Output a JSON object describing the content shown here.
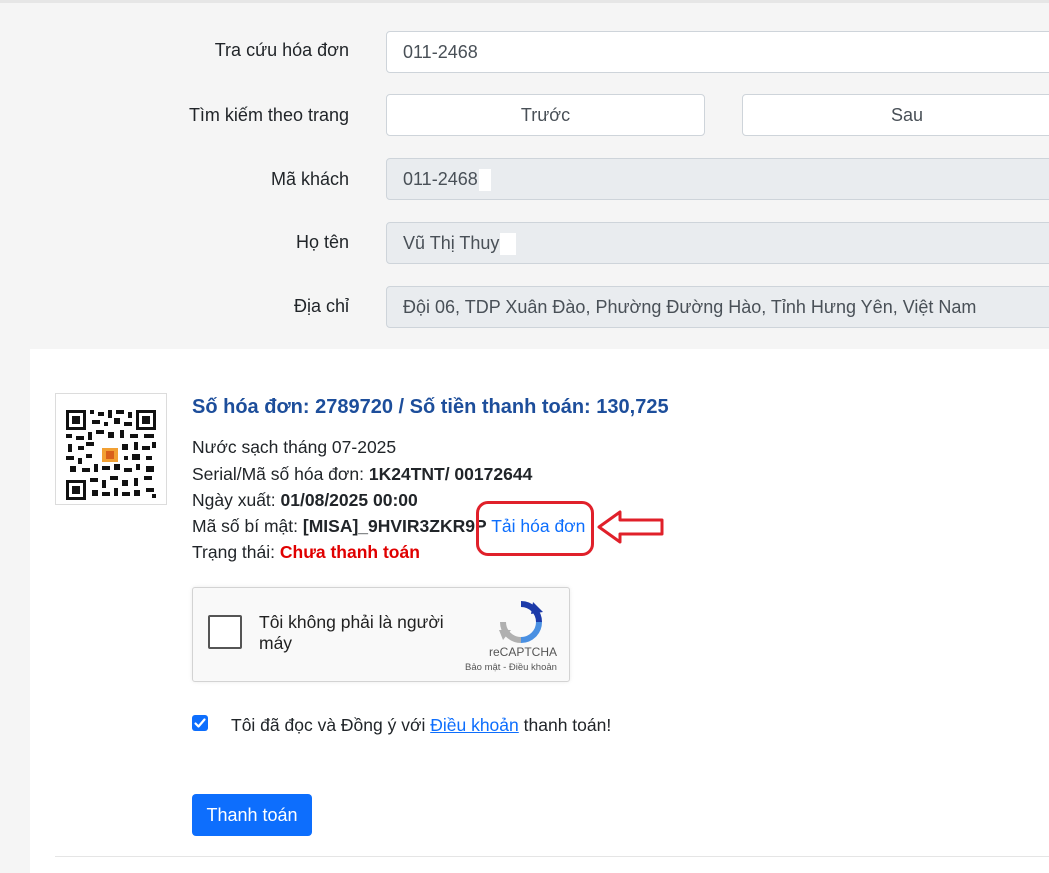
{
  "form": {
    "lookup_label": "Tra cứu hóa đơn",
    "lookup_value": "011-2468",
    "page_search_label": "Tìm kiếm theo trang",
    "prev_label": "Trước",
    "next_label": "Sau",
    "customer_code_label": "Mã khách",
    "customer_code_value": "011-2468",
    "name_label": "Họ tên",
    "name_value": "Vũ Thị Thuy",
    "address_label": "Địa chỉ",
    "address_value": "Đội 06, TDP Xuân Đào, Phường Đường Hào, Tỉnh Hưng Yên, Việt Nam"
  },
  "invoice": {
    "title": "Số hóa đơn: 2789720 / Số tiền thanh toán: 130,725",
    "description": "Nước sạch tháng 07-2025",
    "serial_label": "Serial/Mã số hóa đơn: ",
    "serial_value": "1K24TNT/ 00172644",
    "date_label": "Ngày xuất: ",
    "date_value": "01/08/2025 00:00",
    "secret_label": "Mã số bí mật: ",
    "secret_value": "[MISA]_9HVIR3ZKR9P",
    "download_link": "Tải hóa đơn",
    "status_label": "Trạng thái: ",
    "status_value": "Chưa thanh toán"
  },
  "recaptcha": {
    "label": "Tôi không phải là người máy",
    "brand": "reCAPTCHA",
    "terms": "Bảo mật - Điều khoản"
  },
  "agreement": {
    "prefix": "Tôi đã đọc và Đồng ý với ",
    "link": "Điều khoản",
    "suffix": " thanh toán!",
    "checked": true
  },
  "pay_button": "Thanh toán",
  "colors": {
    "title_blue": "#1d4e9b",
    "link_blue": "#0d6efd",
    "status_red": "#e00000",
    "annotation_red": "#e0202a"
  },
  "icons": [
    "qr-code-icon",
    "recaptcha-logo-icon",
    "checkbox-checked-icon",
    "annotation-arrow-icon"
  ]
}
